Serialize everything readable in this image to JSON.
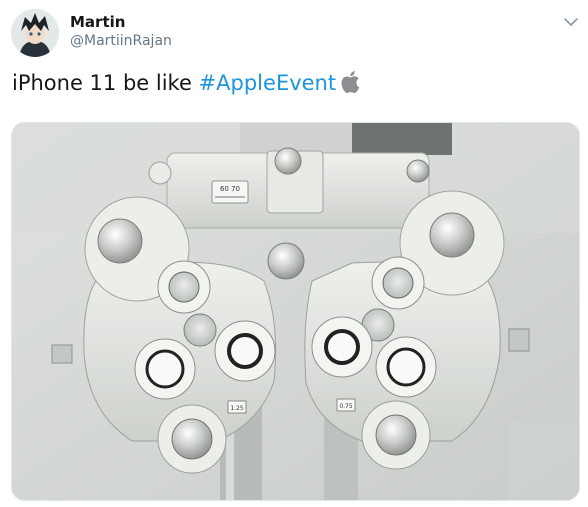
{
  "author": {
    "name": "Martin",
    "handle": "@MartiinRajan"
  },
  "tweet": {
    "text_prefix": "iPhone 11 be like ",
    "hashtag": "#AppleEvent"
  },
  "icons": {
    "menu": "chevron-down-icon",
    "emoji": "apple-logo-icon"
  },
  "media": {
    "alt": "phoropter-photo",
    "scale_left": "60 70",
    "label_center_left": "1.25",
    "label_center_right": "0.75"
  },
  "colors": {
    "link": "#1b95e0",
    "text": "#14171a",
    "secondary": "#657786"
  }
}
